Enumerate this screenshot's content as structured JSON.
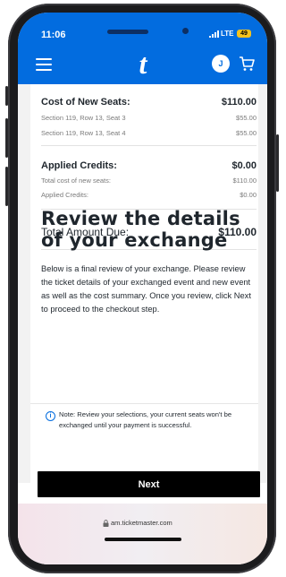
{
  "status_bar": {
    "time": "11:06",
    "network": "LTE",
    "battery": "49"
  },
  "header": {
    "logo": "t",
    "avatar_initial": "J"
  },
  "cost_new": {
    "label": "Cost of New Seats:",
    "value": "$110.00",
    "items": [
      {
        "label": "Section 119, Row 13, Seat 3",
        "value": "$55.00"
      },
      {
        "label": "Section 119, Row 13, Seat 4",
        "value": "$55.00"
      }
    ]
  },
  "credits": {
    "label": "Applied Credits:",
    "value": "$0.00",
    "items": [
      {
        "label": "Total cost of new seats:",
        "value": "$110.00"
      },
      {
        "label": "Applied Credits:",
        "value": "$0.00"
      }
    ]
  },
  "total": {
    "label": "Total Amount Due:",
    "value": "$110.00"
  },
  "review": {
    "title": "Review the details of your exchange",
    "description": "Below is a final review of your exchange. Please review the ticket details of your exchanged event and new event as well as the cost summary. Once you review, click Next to proceed to the checkout step."
  },
  "note": "Note: Review your selections, your current seats won't be exchanged until your payment is successful.",
  "actions": {
    "next_label": "Next"
  },
  "browser": {
    "url": "am.ticketmaster.com"
  },
  "colors": {
    "brand": "#026cdf",
    "button": "#000000"
  }
}
